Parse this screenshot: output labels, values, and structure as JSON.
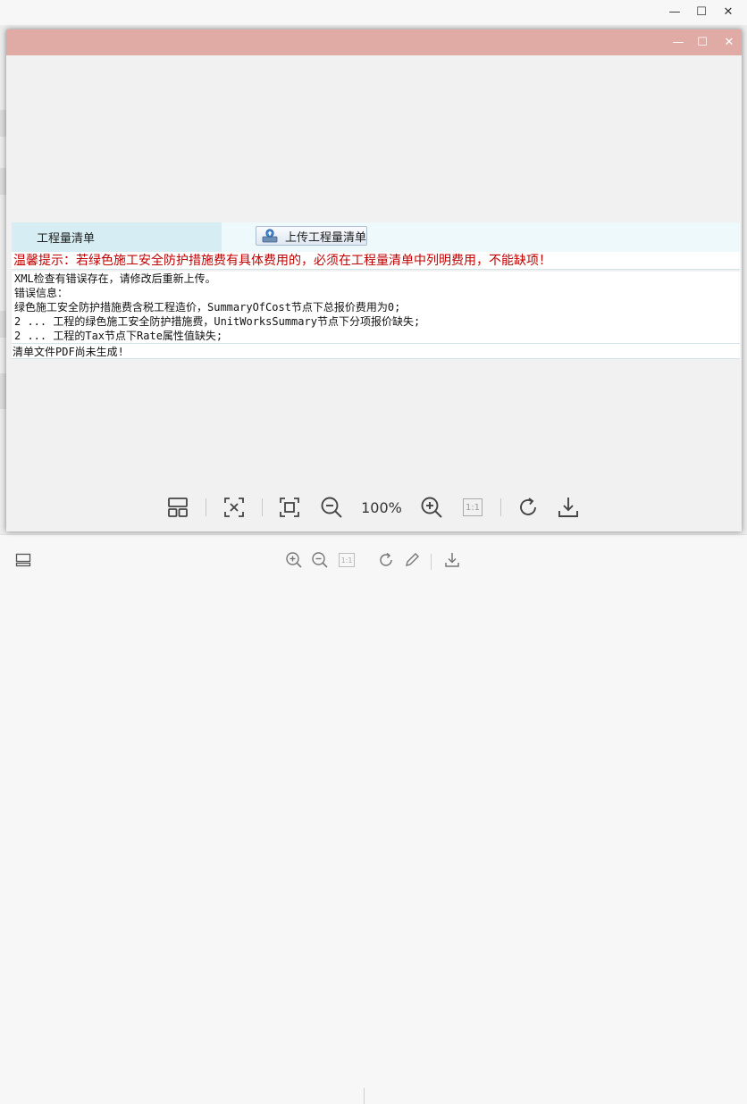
{
  "outer_window": {
    "controls": {
      "minimize": "—",
      "maximize": "☐",
      "close": "✕"
    }
  },
  "viewer_window": {
    "controls": {
      "minimize": "—",
      "maximize": "☐",
      "close": "✕"
    }
  },
  "document": {
    "tab_label": "工程量清单",
    "upload_button_label": "上传工程量清单",
    "tip": "温馨提示：若绿色施工安全防护措施费有具体费用的，必须在工程量清单中列明费用，不能缺项！",
    "error_lines": [
      "XML检查有错误存在，请修改后重新上传。",
      "错误信息：",
      "绿色施工安全防护措施费含税工程造价，SummaryOfCost节点下总报价费用为0;",
      "2 ... 工程的绿色施工安全防护措施费，UnitWorksSummary节点下分项报价缺失;",
      "2 ... 工程的Tax节点下Rate属性值缺失;"
    ],
    "pdf_status": "清单文件PDF尚未生成!"
  },
  "viewer_toolbar": {
    "zoom_level": "100%",
    "actual_size_label": "1:1",
    "icons": [
      "thumbnails-icon",
      "fit-width-icon",
      "fit-page-icon",
      "zoom-out-icon",
      "zoom-in-icon",
      "actual-size-icon",
      "rotate-icon",
      "download-icon"
    ]
  },
  "outer_toolbar": {
    "actual_size_label": "1:1",
    "icons": [
      "thumbnails-icon",
      "zoom-in-icon",
      "zoom-out-icon",
      "actual-size-icon",
      "rotate-icon",
      "edit-icon",
      "download-icon"
    ]
  },
  "colors": {
    "viewer_titlebar": "#e0aaa5",
    "tip_text": "#c00000",
    "tab_bg": "#d6eef3",
    "row_bg": "#eef9fb"
  }
}
